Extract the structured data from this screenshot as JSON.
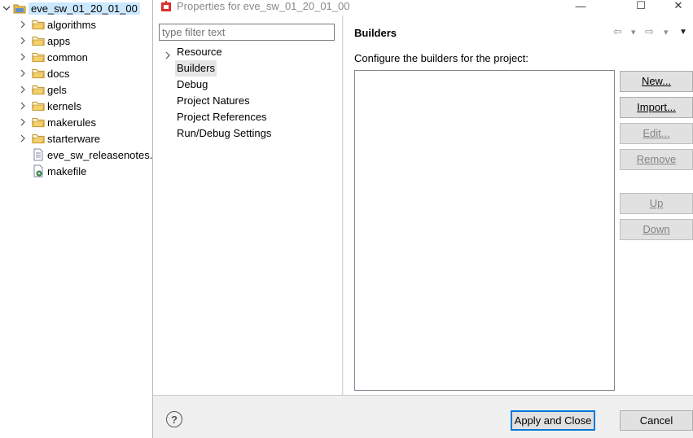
{
  "explorer": {
    "root": {
      "label": "eve_sw_01_20_01_00",
      "twisty": "chevron-down-icon"
    },
    "items": [
      {
        "label": "algorithms",
        "type": "folder"
      },
      {
        "label": "apps",
        "type": "folder"
      },
      {
        "label": "common",
        "type": "folder"
      },
      {
        "label": "docs",
        "type": "folder"
      },
      {
        "label": "gels",
        "type": "folder"
      },
      {
        "label": "kernels",
        "type": "folder"
      },
      {
        "label": "makerules",
        "type": "folder"
      },
      {
        "label": "starterware",
        "type": "folder"
      },
      {
        "label": "eve_sw_releasenotes.p",
        "type": "file"
      },
      {
        "label": "makefile",
        "type": "file"
      }
    ]
  },
  "dialog": {
    "title": "Properties for eve_sw_01_20_01_00",
    "window_buttons": {
      "minimize": "—",
      "maximize": "☐",
      "close": "✕"
    },
    "filter_placeholder": "type filter text",
    "pages": [
      "Resource",
      "Builders",
      "Debug",
      "Project Natures",
      "Project References",
      "Run/Debug Settings"
    ],
    "selected_page": "Builders",
    "page_title": "Builders",
    "description": "Configure the builders for the project:",
    "nav": {
      "back": "⇦",
      "back_menu": "▾",
      "forward": "⇨",
      "forward_menu": "▾",
      "view_menu": "▼"
    },
    "buttons": {
      "new": "New...",
      "import": "Import...",
      "edit": "Edit...",
      "remove": "Remove",
      "up": "Up",
      "down": "Down"
    },
    "footer": {
      "help": "?",
      "apply_close": "Apply and Close",
      "cancel": "Cancel"
    }
  },
  "colors": {
    "selection": "#cce8ff",
    "focus_border": "#0078d7",
    "dialog_bg": "#f0f0f0",
    "title_icon": "#d9302c",
    "folder": "#e8b84d"
  }
}
